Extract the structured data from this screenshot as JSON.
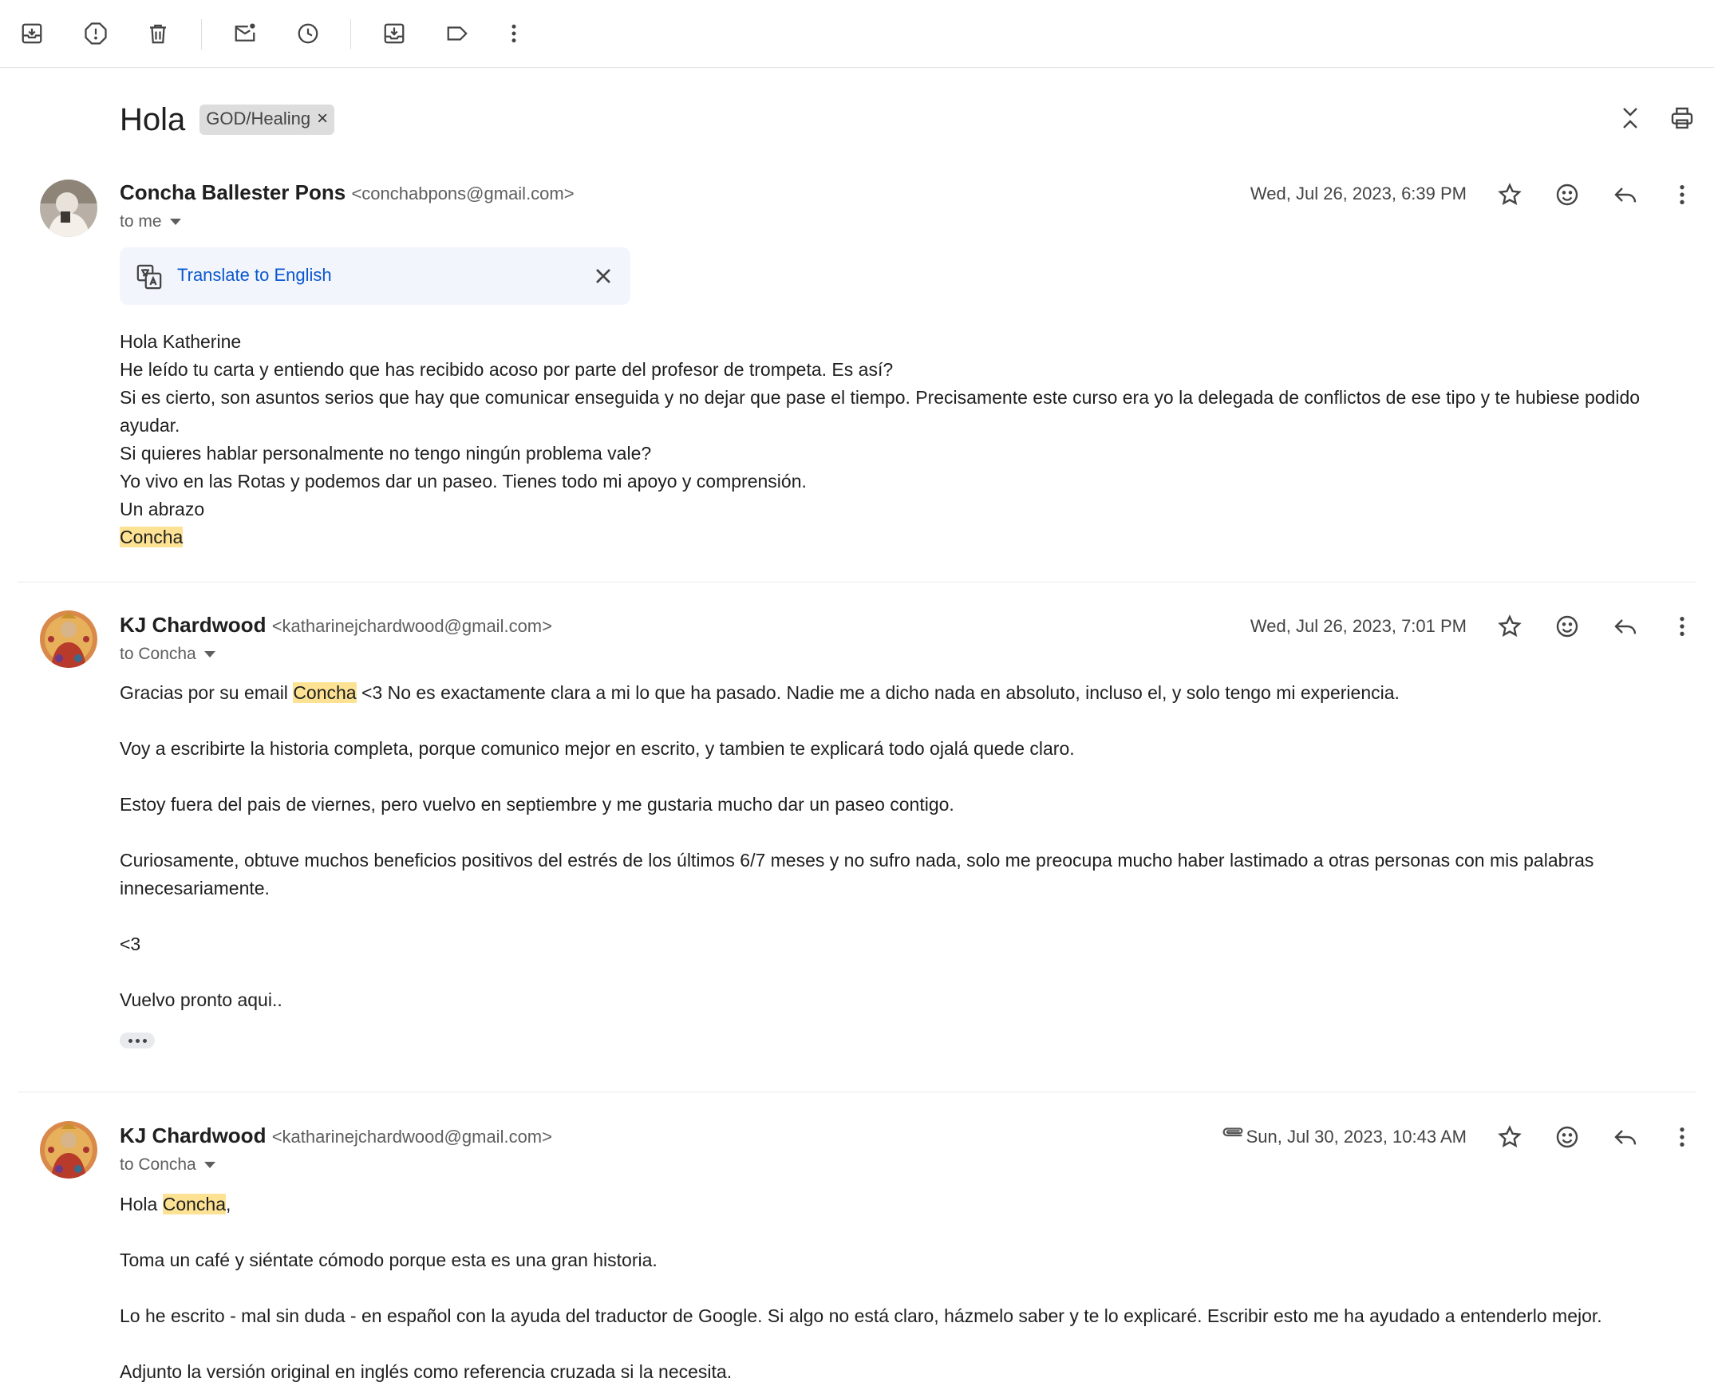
{
  "toolbar": {
    "icons": [
      "archive-icon",
      "report-spam-icon",
      "delete-icon",
      "mark-unread-icon",
      "snooze-icon",
      "move-to-icon",
      "label-icon",
      "more-vert-icon"
    ]
  },
  "thread": {
    "subject": "Hola",
    "label": "GOD/Healing",
    "label_remove": "×"
  },
  "messages": [
    {
      "sender_name": "Concha Ballester Pons",
      "sender_email": "<conchabpons@gmail.com>",
      "to": "to me",
      "date": "Wed, Jul 26, 2023, 6:39 PM",
      "translate_label": "Translate to English",
      "body": [
        "Hola Katherine",
        "He leído tu carta y entiendo que has recibido acoso por parte del profesor de trompeta. Es así?",
        "Si es cierto, son asuntos serios que hay que comunicar enseguida y no dejar que pase el tiempo. Precisamente este curso era yo la delegada de conflictos de ese tipo y te hubiese podido ayudar.",
        "Si quieres hablar personalmente no tengo ningún problema vale?",
        "Yo vivo en las Rotas y podemos dar un paseo. Tienes todo mi apoyo y comprensión.",
        "Un abrazo",
        "Concha"
      ]
    },
    {
      "sender_name": "KJ Chardwood",
      "sender_email": "<katharinejchardwood@gmail.com>",
      "to": "to Concha",
      "date": "Wed, Jul 26, 2023, 7:01 PM",
      "body_p1_pre": "Gracias por su email ",
      "body_p1_hl": "Concha",
      "body_p1_post": " <3 No es exactamente clara a mi lo que ha pasado. Nadie me a dicho nada en absoluto, incluso el, y solo tengo mi experiencia.",
      "body_p2": "Voy a escribirte la historia completa, porque comunico mejor en escrito, y tambien te explicará todo ojalá quede claro.",
      "body_p3": "Estoy fuera del pais de viernes, pero vuelvo en septiembre y me gustaria mucho dar un paseo contigo.",
      "body_p4": "Curiosamente, obtuve muchos beneficios positivos del estrés de los últimos 6/7 meses y no sufro nada, solo me preocupa mucho haber lastimado a otras personas con mis palabras innecesariamente.",
      "body_p5": "<3",
      "body_p6": "Vuelvo pronto aqui.."
    },
    {
      "sender_name": "KJ Chardwood",
      "sender_email": "<katharinejchardwood@gmail.com>",
      "to": "to Concha",
      "date": "Sun, Jul 30, 2023, 10:43 AM",
      "has_attachment": true,
      "body_p1_pre": "Hola ",
      "body_p1_hl": "Concha",
      "body_p1_post": ",",
      "body_p2": "Toma un café y siéntate cómodo porque esta es una gran historia.",
      "body_p3": "Lo he escrito - mal sin duda - en español con la ayuda del traductor de Google. Si algo no está claro, házmelo saber y te lo explicaré. Escribir esto me ha ayudado a entenderlo mejor.",
      "body_p4": "Adjunto la versión original en inglés como referencia cruzada si la necesita."
    }
  ],
  "colors": {
    "highlight": "#fde293",
    "link": "#0b57d0",
    "translate_bg": "#f2f6fc"
  }
}
